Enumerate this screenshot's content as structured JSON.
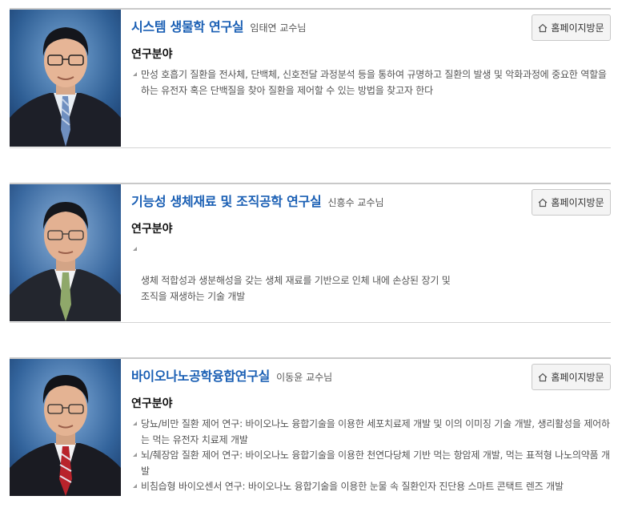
{
  "labs": [
    {
      "name": "시스템 생물학 연구실",
      "professor": "임태연 교수님",
      "visit_label": "홈페이지방문",
      "field_heading": "연구분야",
      "items": [
        "만성 호흡기 질환을 전사체, 단백체, 신호전달 과정분석 등을 통하여 규명하고 질환의 발생 및 악화과정에 중요한 역할을 하는 유전자 혹은 단백질을 찾아 질환을 제어할 수 있는 방법을 찾고자 한다"
      ]
    },
    {
      "name": "기능성 생체재료 및 조직공학 연구실",
      "professor": "신흥수 교수님",
      "visit_label": "홈페이지방문",
      "field_heading": "연구분야",
      "items": [
        "생체 적합성과 생분해성을 갖는 생체 재료를 기반으로 인체 내에 손상된 장기 및\n조직을 재생하는 기술 개발"
      ]
    },
    {
      "name": "바이오나노공학융합연구실",
      "professor": "이동윤 교수님",
      "visit_label": "홈페이지방문",
      "field_heading": "연구분야",
      "items": [
        "당뇨/비만 질환 제어 연구: 바이오나노 융합기술을 이용한 세포치료제 개발 및 이의 이미징 기술 개발, 생리활성을 제어하는 먹는 유전자 치료제 개발",
        "뇌/췌장암 질환 제어 연구: 바이오나노 융합기술을 이용한 천연다당체 기반 먹는 항암제 개발, 먹는 표적형 나노의약품 개발",
        "비침습형 바이오센서 연구: 바이오나노 융합기술을 이용한 눈물 속 질환인자 진단용 스마트 콘택트 렌즈 개발"
      ]
    }
  ],
  "icons": {
    "visit": "home-icon",
    "bullet": "arrow-bullet-icon"
  },
  "colors": {
    "lab_title": "#1a5fb4",
    "border": "#c9c9c9",
    "button_bg": "#f4f4f4"
  }
}
